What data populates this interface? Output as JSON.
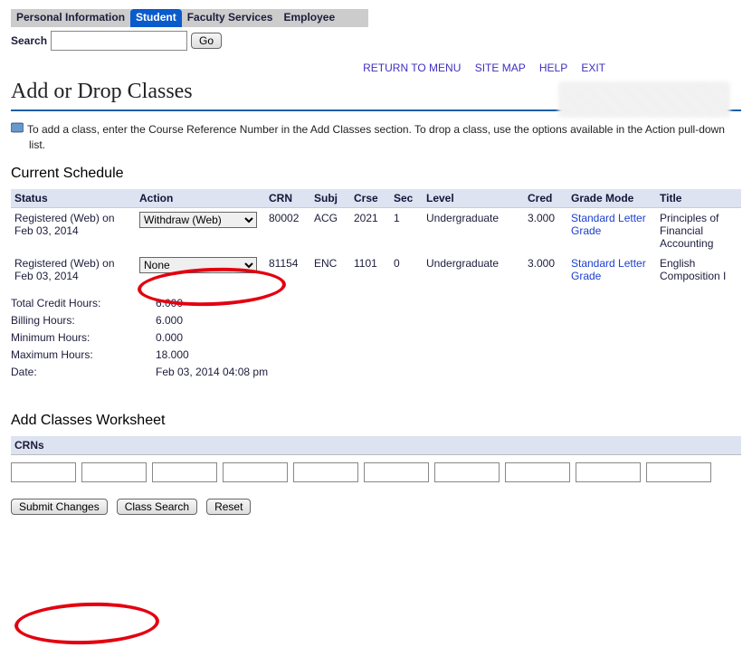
{
  "tabs": [
    "Personal Information",
    "Student",
    "Faculty Services",
    "Employee"
  ],
  "active_tab_index": 1,
  "search": {
    "label": "Search",
    "go": "Go",
    "value": ""
  },
  "toplinks": [
    "RETURN TO MENU",
    "SITE MAP",
    "HELP",
    "EXIT"
  ],
  "page_title": "Add or Drop Classes",
  "info_text": "To add a class, enter the Course Reference Number in the Add Classes section. To drop a class, use the options available in the Action pull-down list.",
  "current_schedule_heading": "Current Schedule",
  "columns": [
    "Status",
    "Action",
    "CRN",
    "Subj",
    "Crse",
    "Sec",
    "Level",
    "Cred",
    "Grade Mode",
    "Title"
  ],
  "rows": [
    {
      "status": "Registered (Web) on Feb 03, 2014",
      "action": "Withdraw (Web)",
      "crn": "80002",
      "subj": "ACG",
      "crse": "2021",
      "sec": "1",
      "level": "Undergraduate",
      "cred": "3.000",
      "grade_mode": "Standard Letter Grade",
      "title": "Principles of Financial Accounting"
    },
    {
      "status": "Registered (Web) on Feb 03, 2014",
      "action": "None",
      "crn": "81154",
      "subj": "ENC",
      "crse": "1101",
      "sec": "0",
      "level": "Undergraduate",
      "cred": "3.000",
      "grade_mode": "Standard Letter Grade",
      "title": "English Composition I"
    }
  ],
  "totals": {
    "total_credit_label": "Total Credit Hours:",
    "total_credit": "6.000",
    "billing_label": "Billing Hours:",
    "billing": "6.000",
    "min_label": "Minimum Hours:",
    "min": "0.000",
    "max_label": "Maximum Hours:",
    "max": "18.000",
    "date_label": "Date:",
    "date": "Feb 03, 2014 04:08 pm"
  },
  "worksheet_heading": "Add Classes Worksheet",
  "crns_label": "CRNs",
  "crn_input_count": 10,
  "buttons": {
    "submit": "Submit Changes",
    "class_search": "Class Search",
    "reset": "Reset"
  }
}
